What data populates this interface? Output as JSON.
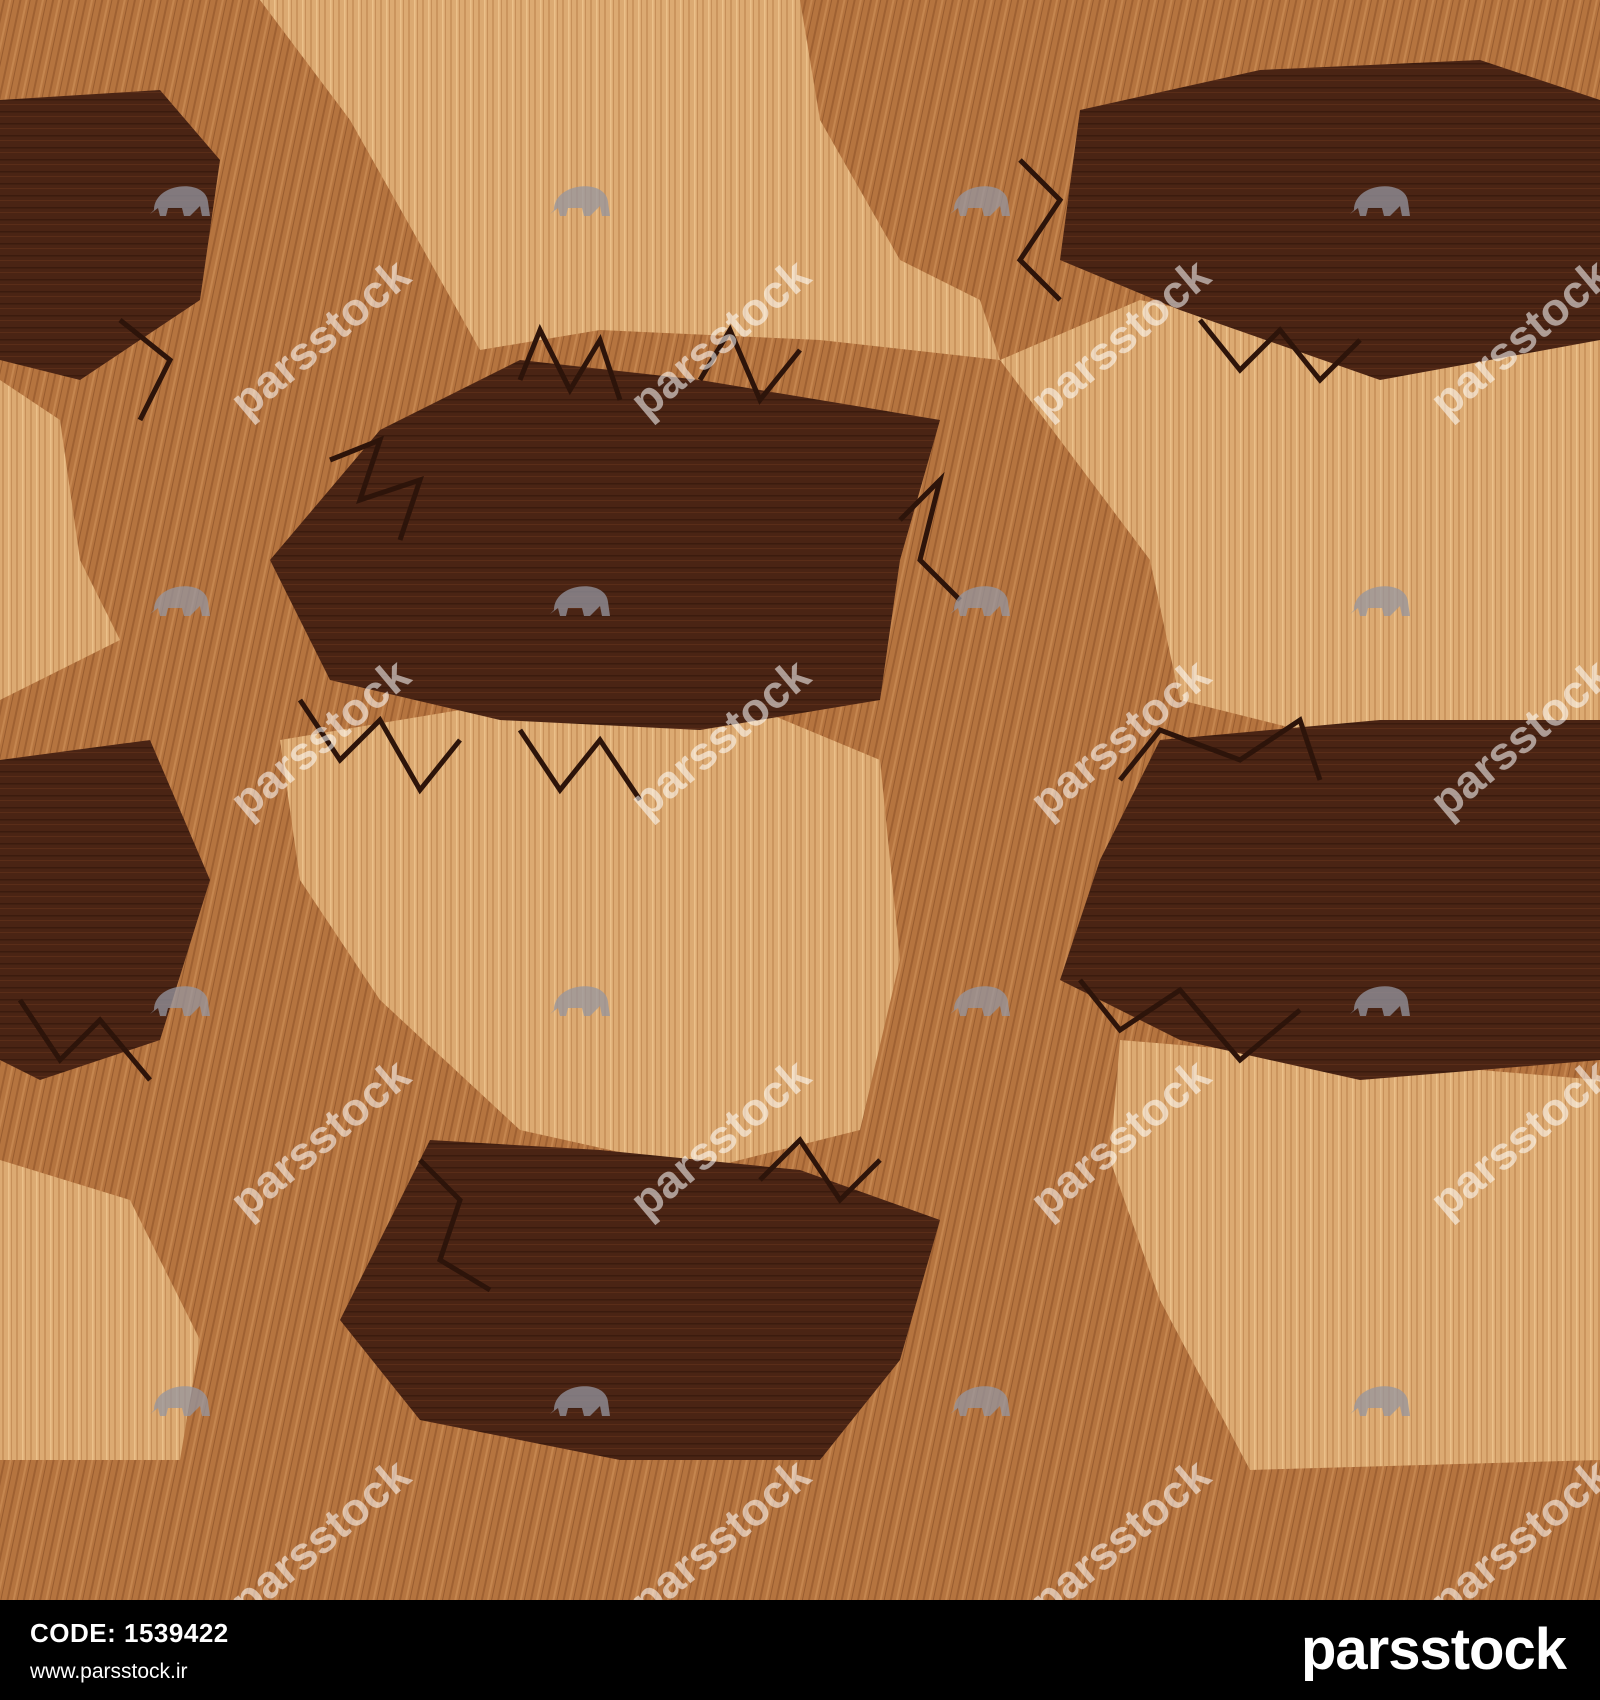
{
  "image": {
    "description_colors": {
      "light_wood": "#d9a56e",
      "medium_wood": "#b0703f",
      "dark_wood": "#4a2414",
      "crack": "#2d140a"
    },
    "watermark": {
      "text": "parsstock",
      "icon": "elephant-icon"
    }
  },
  "footer": {
    "code_label": "CODE:",
    "code_value": "1539422",
    "website": "www.parsstock.ir",
    "brand": "parsstock"
  }
}
